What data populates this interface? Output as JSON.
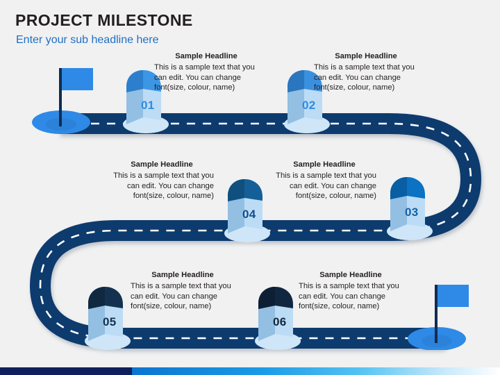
{
  "header": {
    "title": "PROJECT MILESTONE",
    "subtitle": "Enter your sub headline here",
    "title_color": "#231f20",
    "subtitle_color": "#1f6fc4"
  },
  "theme": {
    "background": "#f1f1f1",
    "road_fill": "#103a6e",
    "road_dash": "#ffffff",
    "accent_blue": "#2e8ae6",
    "navy": "#0f1f5c"
  },
  "flags": [
    {
      "name": "start-flag",
      "flag_color": "#2e8ae6",
      "pole_color": "#0f2b52",
      "base_color": "#2e8ae6"
    },
    {
      "name": "end-flag",
      "flag_color": "#2e8ae6",
      "pole_color": "#0f2b52",
      "base_color": "#2e8ae6"
    }
  ],
  "milestones": [
    {
      "number": "01",
      "cap_color": "#3d96e3",
      "cap_shade": "#2c7fcc",
      "face_color": "#bcdcf5",
      "side_color": "#93bfe2",
      "num_color": "#2e8ae6",
      "base_color": "#cfe6f8",
      "headline": "Sample Headline",
      "body": "This is a sample text that you can edit. You can change font(size, colour, name)",
      "align": "left"
    },
    {
      "number": "02",
      "cap_color": "#3a90de",
      "cap_shade": "#2a76bf",
      "face_color": "#bcdcf5",
      "side_color": "#93bfe2",
      "num_color": "#2e8ae6",
      "base_color": "#cfe6f8",
      "headline": "Sample Headline",
      "body": "This is a sample text that you can edit. You can change font(size, colour, name)",
      "align": "left"
    },
    {
      "number": "03",
      "cap_color": "#0b72c4",
      "cap_shade": "#0a5ea3",
      "face_color": "#bcdcf5",
      "side_color": "#93bfe2",
      "num_color": "#1461a8",
      "base_color": "#cfe6f8",
      "headline": "Sample Headline",
      "body": "This is a sample text that you can edit. You can change font(size, colour, name)",
      "align": "right"
    },
    {
      "number": "04",
      "cap_color": "#145f98",
      "cap_shade": "#10507f",
      "face_color": "#bcdcf5",
      "side_color": "#93bfe2",
      "num_color": "#124e86",
      "base_color": "#cfe6f8",
      "headline": "Sample Headline",
      "body": "This is a sample text that you can edit. You can change font(size, colour, name)",
      "align": "right"
    },
    {
      "number": "05",
      "cap_color": "#14324f",
      "cap_shade": "#102840",
      "face_color": "#bcdcf5",
      "side_color": "#93bfe2",
      "num_color": "#12324f",
      "base_color": "#cfe6f8",
      "headline": "Sample Headline",
      "body": "This is a sample text that you can edit. You can change font(size, colour, name)",
      "align": "left"
    },
    {
      "number": "06",
      "cap_color": "#11273f",
      "cap_shade": "#0d1f33",
      "face_color": "#bcdcf5",
      "side_color": "#93bfe2",
      "num_color": "#11273f",
      "base_color": "#cfe6f8",
      "headline": "Sample Headline",
      "body": "This is a sample text that you can edit. You can change font(size, colour, name)",
      "align": "left"
    }
  ],
  "bottom_bar": {
    "dark_color": "#0f1f5c",
    "gradient_from": "#0b74cf",
    "gradient_to": "#ffffff"
  }
}
